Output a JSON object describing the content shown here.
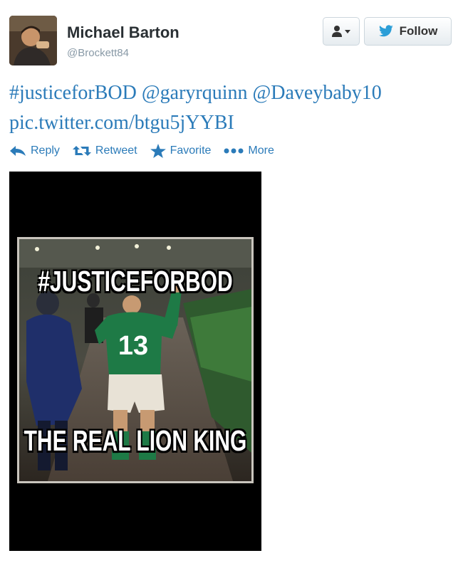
{
  "user": {
    "name": "Michael Barton",
    "handle": "@Brockett84"
  },
  "buttons": {
    "user_menu_icon": "person-dropdown-icon",
    "follow_label": "Follow",
    "follow_icon": "bird-icon"
  },
  "tweet": {
    "hashtag": "#justiceforBOD",
    "mention_1": "@garyrquinn",
    "mention_2": "@Daveybaby10",
    "link": "pic.twitter.com/btgu5jYYBI"
  },
  "actions": [
    {
      "label": "Reply",
      "icon": "reply-icon"
    },
    {
      "label": "Retweet",
      "icon": "retweet-icon"
    },
    {
      "label": "Favorite",
      "icon": "star-icon"
    },
    {
      "label": "More",
      "icon": "more-dots-icon"
    }
  ],
  "media": {
    "caption_top": "#JUSTICEFORBOD",
    "caption_bottom": "THE REAL LION KING",
    "jersey_number": "13"
  },
  "colors": {
    "link": "#2b7bb9",
    "name": "#292f33",
    "handle": "#8899a6",
    "jersey": "#1e7a46"
  }
}
